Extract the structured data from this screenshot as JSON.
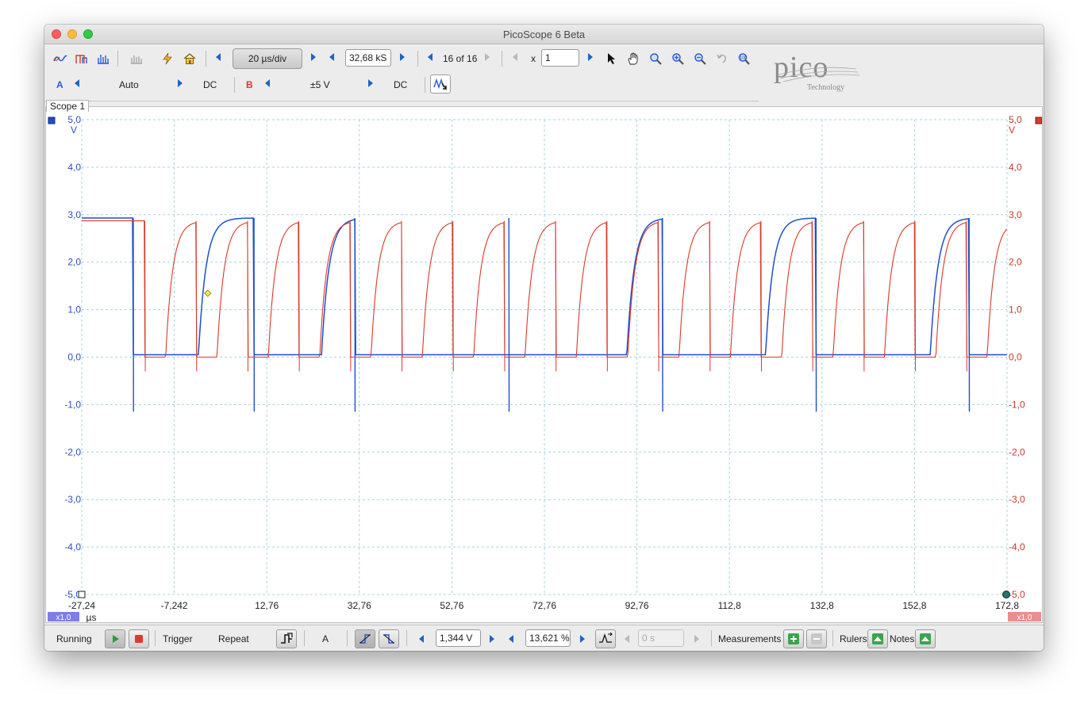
{
  "window": {
    "title": "PicoScope 6 Beta"
  },
  "toolbar": {
    "timebase": "20 µs/div",
    "samples": "32,68 kS",
    "buffer": "16 of 16",
    "zoom_prefix": "x",
    "zoom_value": "1",
    "channel_a": {
      "label": "A",
      "range": "Auto",
      "coupling": "DC"
    },
    "channel_b": {
      "label": "B",
      "range": "±5 V",
      "coupling": "DC"
    }
  },
  "logo": {
    "word": "pico",
    "sub": "Technology"
  },
  "scope": {
    "tab": "Scope 1"
  },
  "chart_data": {
    "type": "line",
    "title": "",
    "xlabel": "µs",
    "x_ticks": [
      "-27,24",
      "-7,242",
      "12,76",
      "32,76",
      "52,76",
      "72,76",
      "92,76",
      "112,8",
      "132,8",
      "152,8",
      "172,8"
    ],
    "xlim": [
      -27.24,
      172.8
    ],
    "left_unit": "V",
    "right_unit": "V",
    "y_ticks_left": [
      "5,0",
      "4,0",
      "3,0",
      "2,0",
      "1,0",
      "0,0",
      "-1,0",
      "-2,0",
      "-3,0",
      "-4,0",
      "-5,0"
    ],
    "y_ticks_right": [
      "5,0",
      "4,0",
      "3,0",
      "2,0",
      "1,0",
      "0,0",
      "-1,0",
      "-2,0",
      "-3,0",
      "-4,0",
      "-5,0"
    ],
    "ylim": [
      -5,
      5
    ],
    "grid": true,
    "left_scale": "x1,0",
    "right_scale": "x1,0",
    "trigger_marker": {
      "x": 0,
      "y": 1.344
    },
    "series": [
      {
        "name": "A",
        "color": "#1f4fcc",
        "high": 2.93,
        "low": 0.05,
        "spike": -1.15,
        "falls": [
          -16.1,
          10.0,
          31.8,
          65.1,
          98.3,
          131.5,
          164.6
        ],
        "rises": [
          -2.0,
          24.6,
          90.6,
          120.6,
          156.2
        ],
        "tau": 1.6
      },
      {
        "name": "B",
        "color": "#d93a2a",
        "high": 2.87,
        "low": 0.0,
        "spike": -0.3,
        "t_zero": -13.6,
        "period": 11.1,
        "low_time": 4.5,
        "tau": 1.5
      }
    ]
  },
  "statusbar": {
    "state": "Running",
    "trigger_label": "Trigger",
    "trigger_mode": "Repeat",
    "source": "A",
    "threshold": "1,344 V",
    "pretrigger": "13,621 %",
    "delay": "0 s",
    "measurements": "Measurements",
    "rulers": "Rulers",
    "notes": "Notes"
  }
}
